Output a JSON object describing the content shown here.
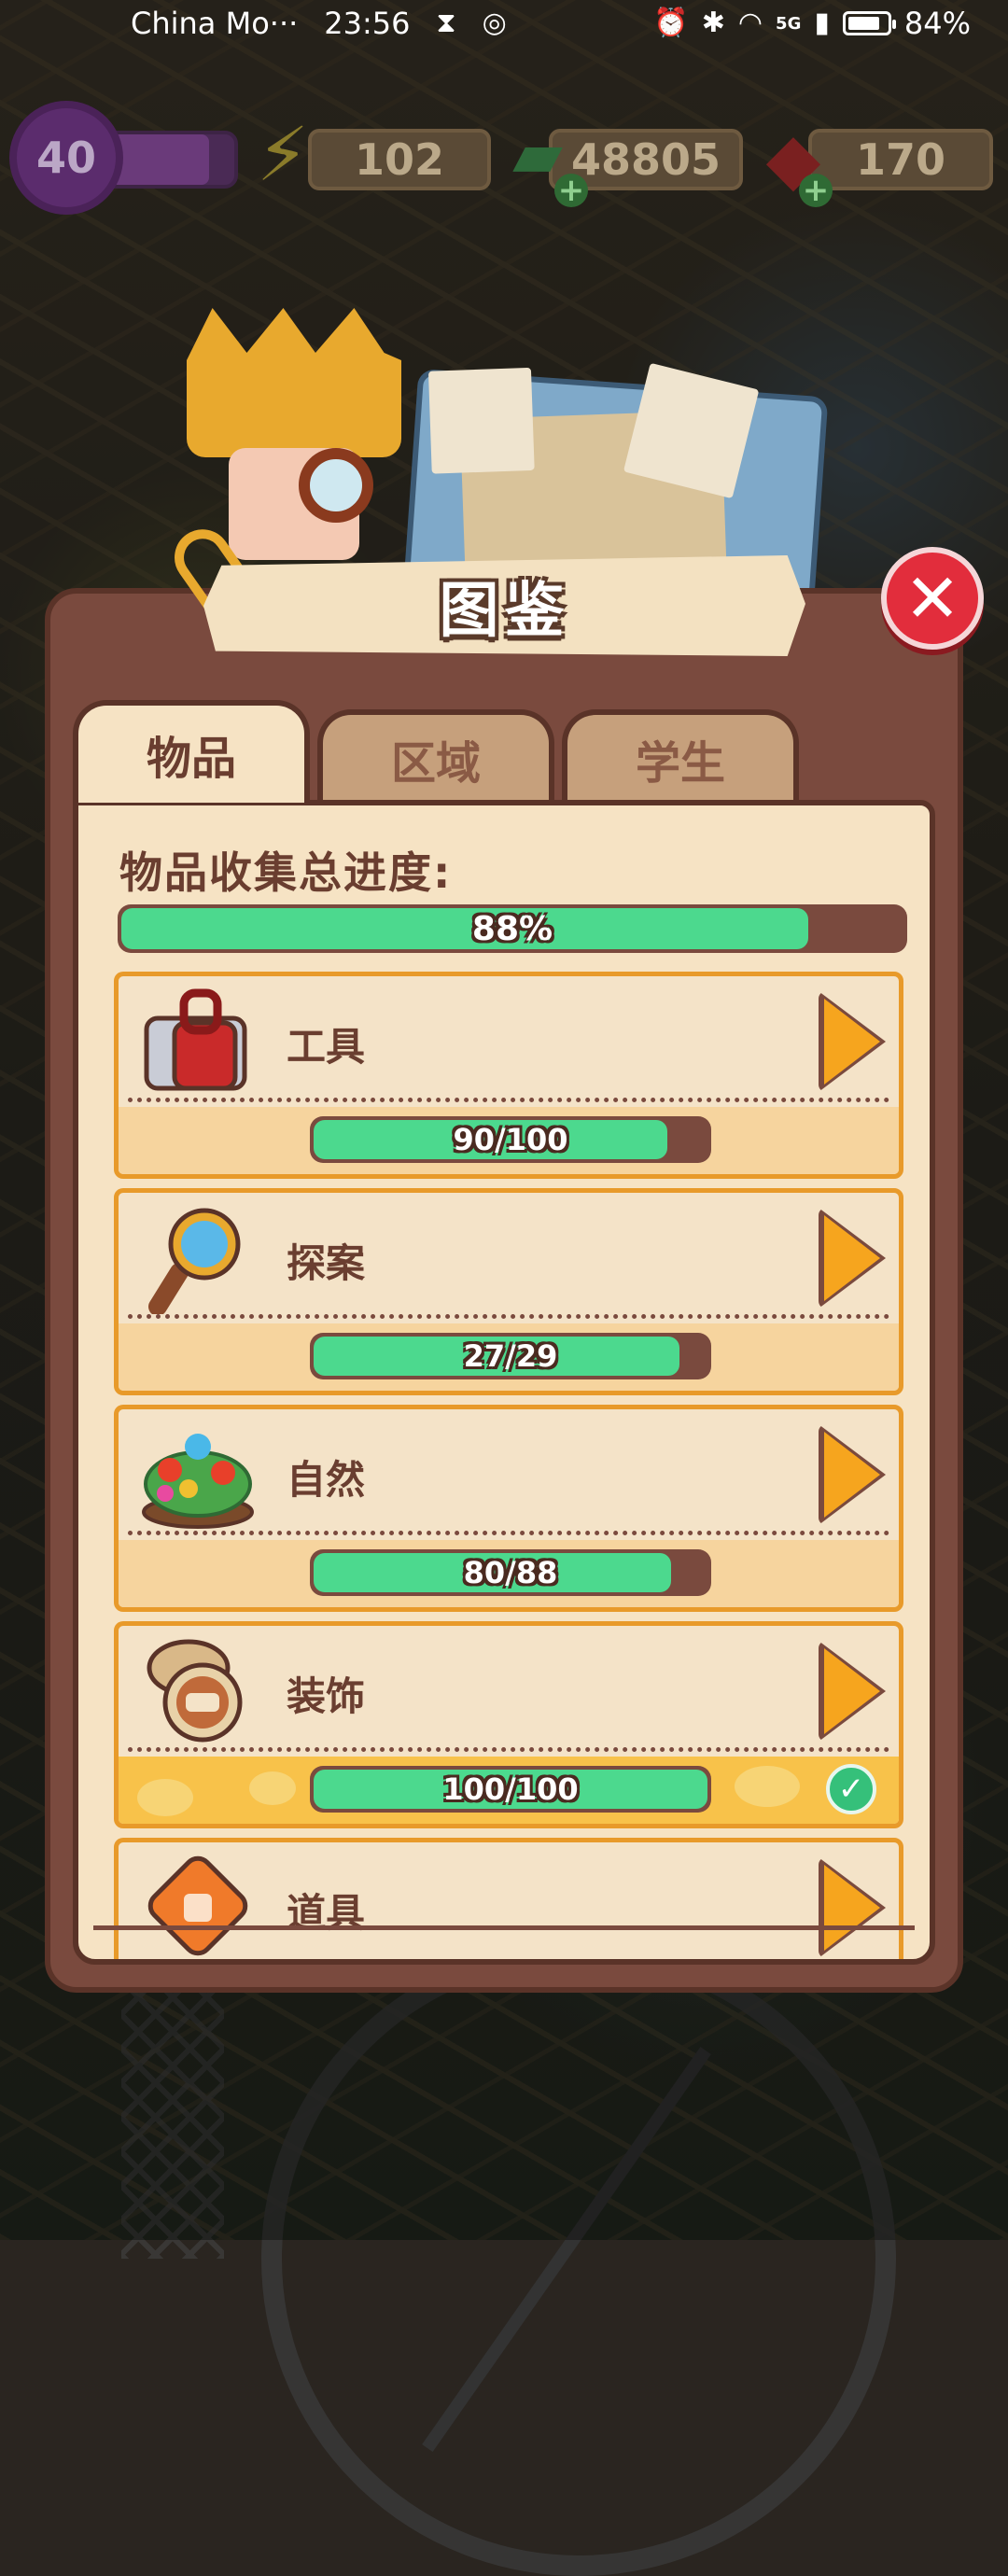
{
  "status_bar": {
    "carrier": "China Mo···",
    "time": "23:56",
    "signal_label": "5G",
    "battery_percent": "84%",
    "battery_level": 0.84
  },
  "resources": {
    "level": "40",
    "energy": "102",
    "cash": "48805",
    "gems": "170"
  },
  "dialog": {
    "title": "图鉴",
    "tabs": [
      {
        "label": "物品",
        "active": true
      },
      {
        "label": "区域",
        "active": false
      },
      {
        "label": "学生",
        "active": false
      }
    ],
    "progress_title": "物品收集总进度:",
    "overall_progress_text": "88%",
    "overall_progress": 0.88,
    "categories": [
      {
        "name": "工具",
        "progress_text": "90/100",
        "progress": 0.9,
        "icon": "toolbox-icon",
        "complete": false
      },
      {
        "name": "探案",
        "progress_text": "27/29",
        "progress": 0.931,
        "icon": "magnifier-icon",
        "complete": false
      },
      {
        "name": "自然",
        "progress_text": "80/88",
        "progress": 0.909,
        "icon": "flower-bush-icon",
        "complete": false
      },
      {
        "name": "装饰",
        "progress_text": "100/100",
        "progress": 1.0,
        "icon": "pocket-watch-icon",
        "complete": true
      },
      {
        "name": "道具",
        "progress_text": "",
        "progress": null,
        "icon": "prop-box-icon",
        "complete": false
      }
    ]
  },
  "colors": {
    "panel": "#7a4a3e",
    "progress_fill": "#4cd98e",
    "accent_orange": "#f6a51e",
    "close_red": "#e22d3c"
  }
}
